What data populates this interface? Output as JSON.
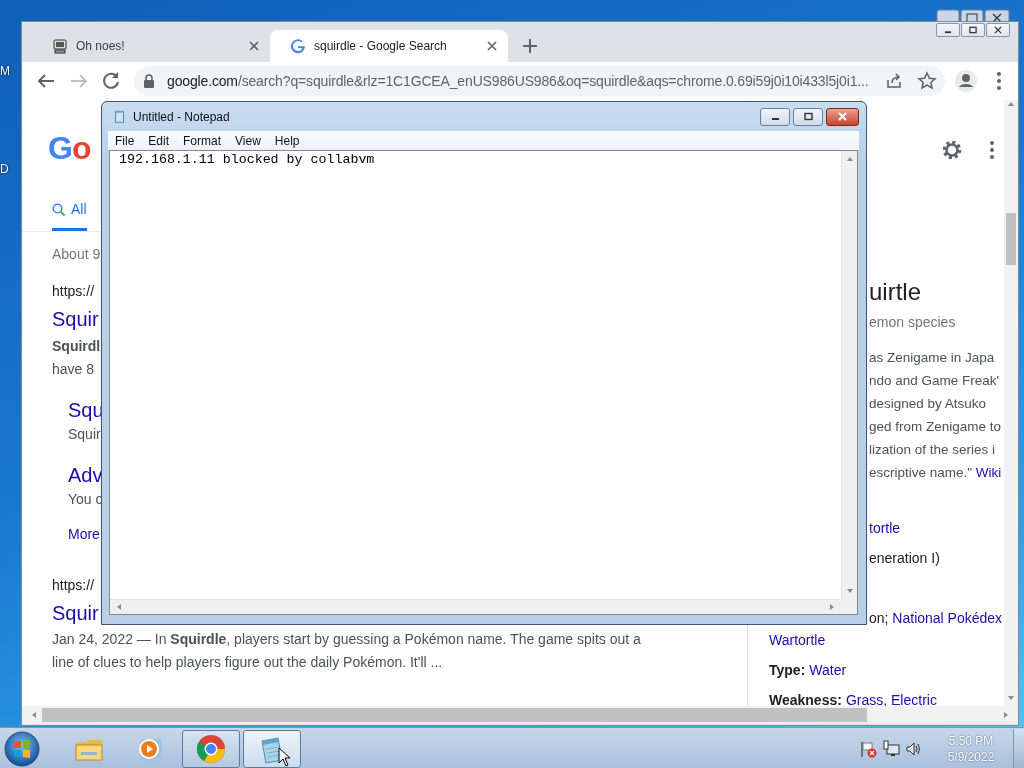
{
  "desktop": {
    "icon_labels": [
      "M",
      "D"
    ]
  },
  "browser": {
    "tabs": [
      {
        "title": "Oh noes!",
        "kind": "computer",
        "selected": false
      },
      {
        "title": "squirdle - Google Search",
        "kind": "google",
        "selected": true
      }
    ],
    "address": {
      "host": "google.com",
      "path": "/search?q=squirdle&rlz=1C1GCEA_enUS986US986&oq=squirdle&aqs=chrome.0.69i59j0i10i433l5j0i1..."
    },
    "page": {
      "logo": "Go",
      "nav_tabs": [
        {
          "label": "All",
          "selected": true
        }
      ],
      "result_count": "About 9",
      "results": [
        {
          "url": "https://",
          "title": "Squir",
          "snippet_lines": [
            "**Squirdl**",
            "have 8"
          ],
          "sitelinks": [
            {
              "title": "Squ",
              "snippet": "Squir"
            },
            {
              "title": "Adv",
              "snippet": "You c"
            }
          ],
          "more": "More"
        },
        {
          "url": "https://",
          "title": "Squir",
          "snippet": "Jan 24, 2022 — In **Squirdle**, players start by guessing a Pokémon name. The game spits out a line of clues to help players figure out the daily Pokémon. It'll ..."
        }
      ],
      "knowledge_panel": {
        "title": "uirtle",
        "subtitle": "emon species",
        "description": [
          {
            "text": "as Zenigame in Japa"
          },
          {
            "text": "ndo and Game Freak'"
          },
          {
            "text": "designed by Atsuko"
          },
          {
            "text": "ged from Zenigame to"
          },
          {
            "text": "lization of the series i"
          },
          {
            "text": "escriptive name.\" ",
            "link": "Wiki"
          }
        ],
        "facts": [
          {
            "parts": [
              {
                "text": "tortle",
                "link": true
              }
            ]
          },
          {
            "parts": [
              {
                "text": "eneration I)",
                "link": false
              }
            ]
          },
          {
            "parts": [
              {
                "text": "on; ",
                "link": false
              },
              {
                "text": "National Pokédex",
                "link": true
              }
            ]
          },
          {
            "parts": [
              {
                "text": "Wartortle",
                "link": true
              }
            ]
          },
          {
            "label": "Type:",
            "parts": [
              {
                "text": "Water",
                "link": true
              }
            ]
          },
          {
            "label": "Weakness:",
            "parts": [
              {
                "text": "Grass",
                "link": true
              },
              {
                "text": ", ",
                "link": false
              },
              {
                "text": "Electric",
                "link": true
              }
            ]
          }
        ]
      }
    }
  },
  "notepad": {
    "title": "Untitled - Notepad",
    "menu": [
      "File",
      "Edit",
      "Format",
      "View",
      "Help"
    ],
    "text": "192.168.1.11 blocked by collabvm"
  },
  "taskbar": {
    "apps": [
      {
        "kind": "explorer",
        "running": false,
        "selected": false
      },
      {
        "kind": "media",
        "running": false,
        "selected": false
      },
      {
        "kind": "chrome",
        "running": true,
        "selected": false
      },
      {
        "kind": "notepad",
        "running": true,
        "selected": true
      }
    ],
    "clock": {
      "time": "5:50 PM",
      "date": "5/9/2022"
    }
  }
}
